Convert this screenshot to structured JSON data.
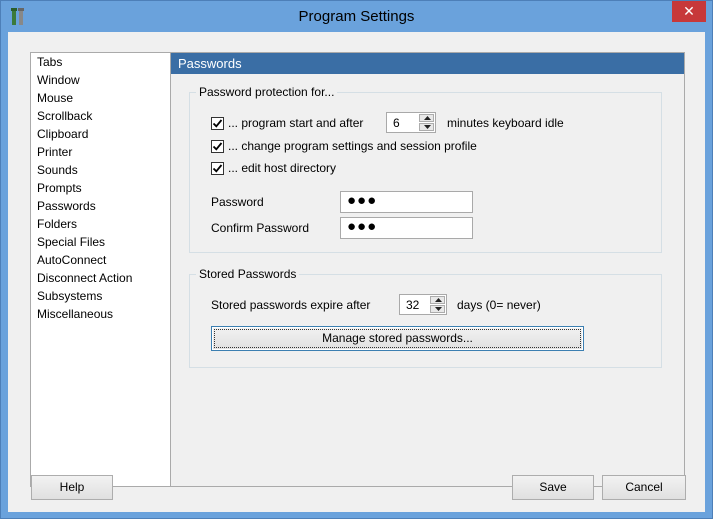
{
  "window": {
    "title": "Program Settings",
    "close_glyph": "✕",
    "icon": "wrench-icon"
  },
  "sidebar": {
    "items": [
      {
        "label": "Tabs"
      },
      {
        "label": "Window"
      },
      {
        "label": "Mouse"
      },
      {
        "label": "Scrollback"
      },
      {
        "label": "Clipboard"
      },
      {
        "label": "Printer"
      },
      {
        "label": "Sounds"
      },
      {
        "label": "Prompts"
      },
      {
        "label": "Passwords"
      },
      {
        "label": "Folders"
      },
      {
        "label": "Special Files"
      },
      {
        "label": "AutoConnect"
      },
      {
        "label": "Disconnect Action"
      },
      {
        "label": "Subsystems"
      },
      {
        "label": "Miscellaneous"
      }
    ]
  },
  "panel": {
    "header": "Passwords",
    "protection": {
      "title": "Password protection for...",
      "start_label": "... program start and after",
      "start_checked": true,
      "idle_minutes": "6",
      "idle_suffix": "minutes keyboard idle",
      "change_label": "... change program settings and session profile",
      "change_checked": true,
      "hostdir_label": "... edit host directory",
      "hostdir_checked": true,
      "password_label": "Password",
      "password_value": "●●●",
      "confirm_label": "Confirm Password",
      "confirm_value": "●●●"
    },
    "stored": {
      "title": "Stored Passwords",
      "expire_label": "Stored passwords expire after",
      "expire_days": "32",
      "expire_suffix": "days (0= never)",
      "manage_button": "Manage stored passwords..."
    }
  },
  "footer": {
    "help": "Help",
    "save": "Save",
    "cancel": "Cancel"
  },
  "colors": {
    "titlebar": "#6aa2dc",
    "panel_header": "#3a6ea5",
    "close": "#c7383a"
  }
}
